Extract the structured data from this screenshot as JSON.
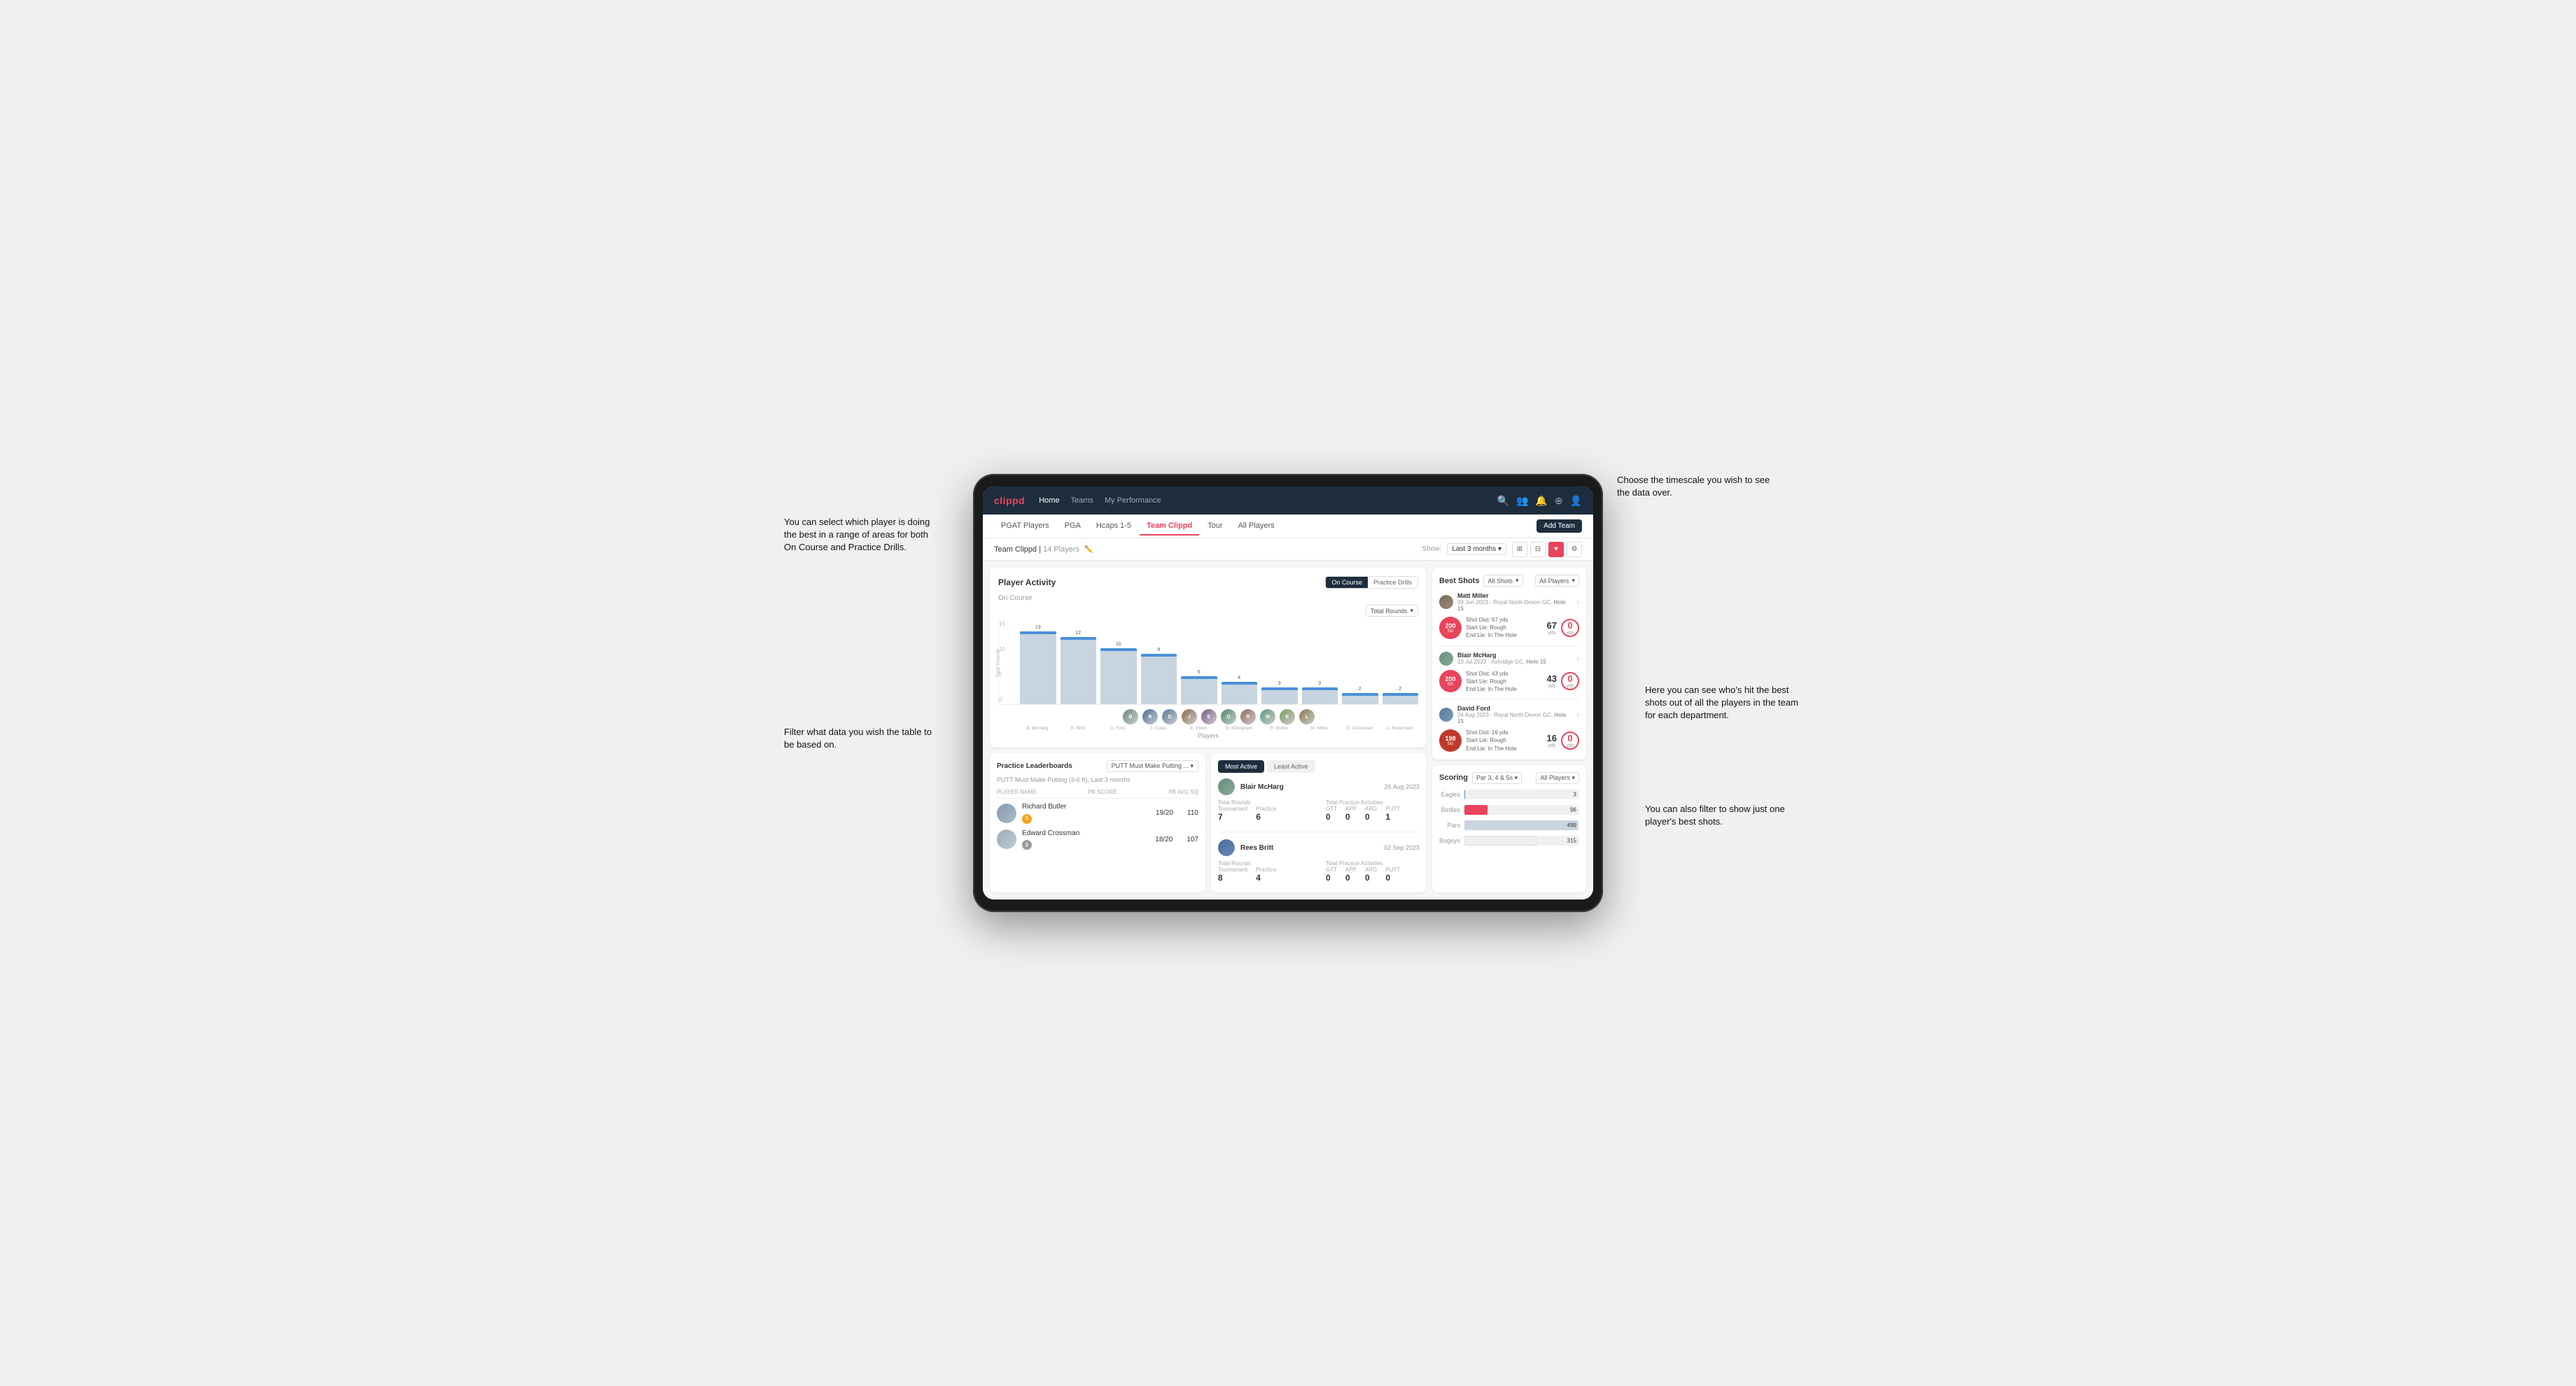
{
  "annotations": {
    "top_right": "Choose the timescale you\nwish to see the data over.",
    "top_left": "You can select which player is\ndoing the best in a range of\nareas for both On Course and\nPractice Drills.",
    "mid_left": "Filter what data you wish the\ntable to be based on.",
    "bottom_right1": "Here you can see who's hit\nthe best shots out of all the\nplayers in the team for\neach department.",
    "bottom_right2": "You can also filter to show\njust one player's best shots."
  },
  "nav": {
    "logo": "clippd",
    "links": [
      "Home",
      "Teams",
      "My Performance"
    ],
    "icons": [
      "search",
      "people",
      "bell",
      "add-circle",
      "profile"
    ]
  },
  "sub_tabs": {
    "tabs": [
      "PGAT Players",
      "PGA",
      "Hcaps 1-5",
      "Team Clippd",
      "Tour",
      "All Players"
    ],
    "active": "Team Clippd",
    "add_button": "Add Team"
  },
  "team_header": {
    "name": "Team Clippd",
    "member_count": "14 Players",
    "show_label": "Show:",
    "timescale": "Last 3 months",
    "view_options": [
      "grid-list",
      "grid",
      "heart",
      "settings"
    ]
  },
  "player_activity": {
    "title": "Player Activity",
    "toggles": [
      "On Course",
      "Practice Drills"
    ],
    "active_toggle": "On Course",
    "section_label": "On Course",
    "chart_dropdown": "Total Rounds",
    "y_axis_label": "Total Rounds",
    "y_axis_values": [
      "15",
      "10",
      "5",
      "0"
    ],
    "x_axis_title": "Players",
    "bars": [
      {
        "player": "B. McHarg",
        "value": 13,
        "color": "#c8d4e0",
        "initials": "BM"
      },
      {
        "player": "R. Britt",
        "value": 12,
        "color": "#c8d4e0",
        "initials": "RB"
      },
      {
        "player": "D. Ford",
        "value": 10,
        "color": "#c8d4e0",
        "initials": "DF"
      },
      {
        "player": "J. Coles",
        "value": 9,
        "color": "#c8d4e0",
        "initials": "JC"
      },
      {
        "player": "E. Ebert",
        "value": 5,
        "color": "#c8d4e0",
        "initials": "EE"
      },
      {
        "player": "O. Billingham",
        "value": 4,
        "color": "#c8d4e0",
        "initials": "OB"
      },
      {
        "player": "R. Butler",
        "value": 3,
        "color": "#c8d4e0",
        "initials": "RB2"
      },
      {
        "player": "M. Miller",
        "value": 3,
        "color": "#c8d4e0",
        "initials": "MM"
      },
      {
        "player": "E. Crossman",
        "value": 2,
        "color": "#c8d4e0",
        "initials": "EC"
      },
      {
        "player": "L. Robertson",
        "value": 2,
        "color": "#c8d4e0",
        "initials": "LR"
      }
    ]
  },
  "practice_leaderboards": {
    "title": "Practice Leaderboards",
    "dropdown": "PUTT Must Make Putting ...",
    "subtitle": "PUTT Must Make Putting (3-6 ft), Last 3 months",
    "col_headers": [
      "PLAYER NAME",
      "PB SCORE",
      "PB AVG SQ"
    ],
    "players": [
      {
        "name": "Richard Butler",
        "badge": "1",
        "badge_type": "gold",
        "pb_score": "19/20",
        "pb_avg": "110"
      },
      {
        "name": "Edward Crossman",
        "badge": "2",
        "badge_type": "silver",
        "pb_score": "18/20",
        "pb_avg": "107"
      }
    ]
  },
  "most_active": {
    "tabs": [
      "Most Active",
      "Least Active"
    ],
    "active_tab": "Most Active",
    "players": [
      {
        "name": "Blair McHarg",
        "date": "26 Aug 2023",
        "total_rounds_label": "Total Rounds",
        "tournament": 7,
        "practice": 6,
        "total_practice_label": "Total Practice Activities",
        "gtt": 0,
        "app": 0,
        "arg": 0,
        "putt": 1
      },
      {
        "name": "Rees Britt",
        "date": "02 Sep 2023",
        "total_rounds_label": "Total Rounds",
        "tournament": 8,
        "practice": 4,
        "total_practice_label": "Total Practice Activities",
        "gtt": 0,
        "app": 0,
        "arg": 0,
        "putt": 0
      }
    ]
  },
  "best_shots": {
    "title": "Best Shots",
    "filter": "All Shots",
    "all_players": "All Players",
    "players": [
      {
        "name": "Matt Miller",
        "date": "09 Jun 2023",
        "course": "Royal North Devon GC",
        "hole": "Hole 15",
        "badge_val": "200",
        "badge_sub": "SG",
        "shot_dist": "Shot Dist: 67 yds",
        "start_lie": "Start Lie: Rough",
        "end_lie": "End Lie: In The Hole",
        "metric1_val": "67",
        "metric1_unit": "yds",
        "metric2_val": "0",
        "metric2_unit": "yds"
      },
      {
        "name": "Blair McHarg",
        "date": "23 Jul 2023",
        "course": "Ashridge GC",
        "hole": "Hole 15",
        "badge_val": "200",
        "badge_sub": "SG",
        "shot_dist": "Shot Dist: 43 yds",
        "start_lie": "Start Lie: Rough",
        "end_lie": "End Lie: In The Hole",
        "metric1_val": "43",
        "metric1_unit": "yds",
        "metric2_val": "0",
        "metric2_unit": "yds"
      },
      {
        "name": "David Ford",
        "date": "24 Aug 2023",
        "course": "Royal North Devon GC",
        "hole": "Hole 15",
        "badge_val": "198",
        "badge_sub": "SG",
        "shot_dist": "Shot Dist: 16 yds",
        "start_lie": "Start Lie: Rough",
        "end_lie": "End Lie: In The Hole",
        "metric1_val": "16",
        "metric1_unit": "yds",
        "metric2_val": "0",
        "metric2_unit": "yds"
      }
    ]
  },
  "scoring": {
    "title": "Scoring",
    "filter": "Par 3, 4 & 5s",
    "all_players": "All Players",
    "categories": [
      {
        "label": "Eagles",
        "value": 3,
        "max": 500,
        "color": "#4a90d9"
      },
      {
        "label": "Birdies",
        "value": 96,
        "max": 500,
        "color": "#e8445a"
      },
      {
        "label": "Pars",
        "value": 499,
        "max": 500,
        "color": "#c8d4e0"
      },
      {
        "label": "Bogeys",
        "value": 315,
        "max": 500,
        "color": "#f5a623"
      }
    ]
  }
}
